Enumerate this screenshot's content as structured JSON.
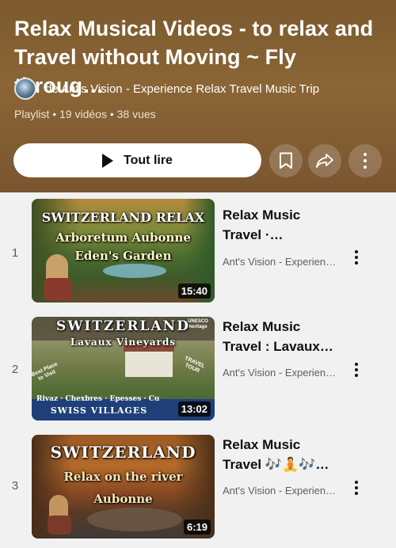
{
  "playlist": {
    "title": "Relax Musical Videos - to relax and\nTravel without Moving ~ Fly throug…",
    "channel": "de Ant's Vision - Experience Relax Travel Music Trip",
    "meta": "Playlist • 19 vidéos • 38 vues",
    "play_all_label": "Tout lire",
    "icons": {
      "save": "bookmark-icon",
      "share": "share-icon",
      "more": "more-vert-icon"
    }
  },
  "videos": [
    {
      "index": "1",
      "title": "Relax Music\nTravel ·…",
      "channel": "Ant's Vision - Experien…",
      "duration": "15:40",
      "thumb": {
        "line1": "SWITZERLAND RELAX",
        "line2": "Arboretum Aubonne",
        "line3": "Eden's Garden"
      }
    },
    {
      "index": "2",
      "title": "Relax Music\nTravel : Lavaux…",
      "channel": "Ant's Vision - Experien…",
      "duration": "13:02",
      "thumb": {
        "line1": "SWITZERLAND",
        "line2": "Lavaux Vineyards",
        "line3": "SWISS VILLAGES",
        "badge": "UNESCO heritage",
        "villages": "Rivaz · Chexbres · Epesses · Cu",
        "left_note": "Best Place to Visit",
        "right_note": "TRAVEL TOUR"
      }
    },
    {
      "index": "3",
      "title": "Relax Music\nTravel 🎶🧘🎶…",
      "channel": "Ant's Vision - Experien…",
      "duration": "6:19",
      "thumb": {
        "line1": "SWITZERLAND",
        "line2": "Relax on the river",
        "line3": "Aubonne"
      }
    }
  ]
}
